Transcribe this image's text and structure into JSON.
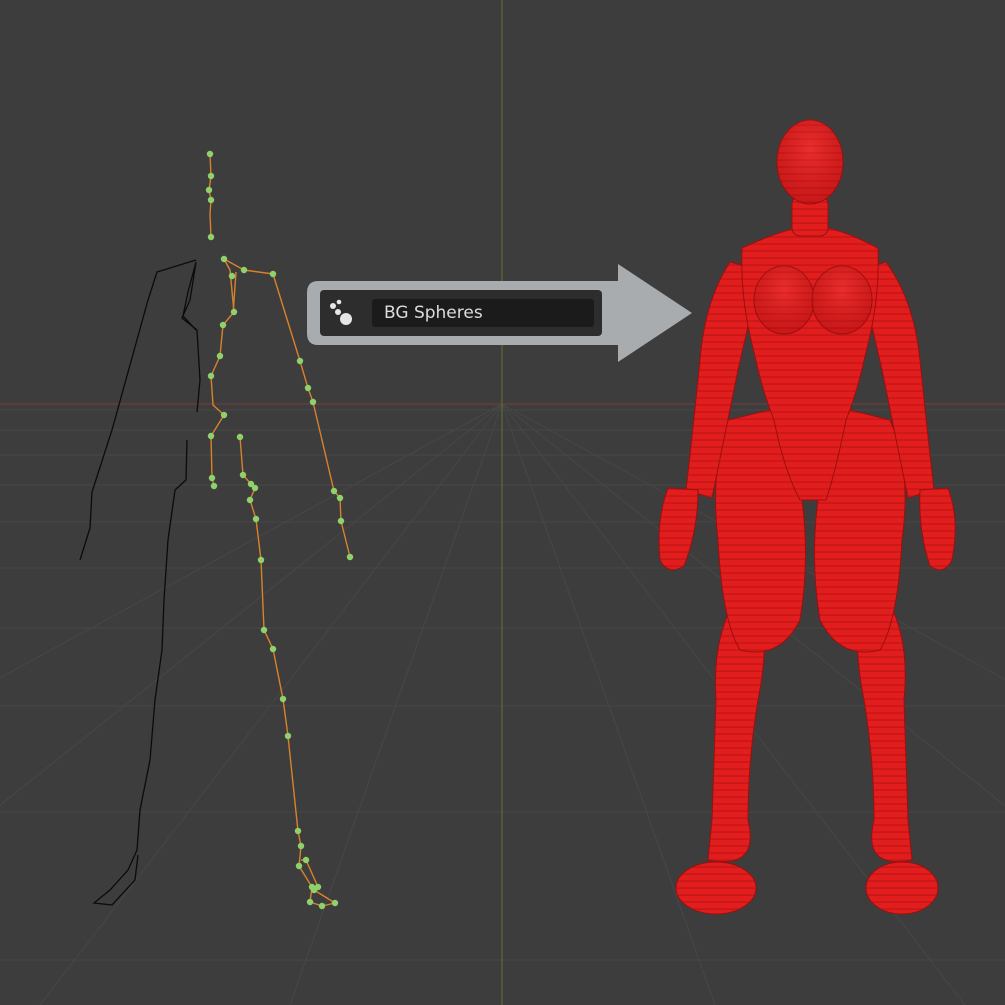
{
  "viewport": {
    "background": "#3d3d3d",
    "grid_color": "#464646",
    "axis_color_x": "#6b4040",
    "axis_color_y": "#5a6e33"
  },
  "armature": {
    "bone_color": "#d9822b",
    "joint_color": "#8fd16a",
    "outline_color": "#0a0a0a"
  },
  "callout": {
    "fill": "#a9acaf",
    "icon": "spheres-icon",
    "field_value": "BG Spheres"
  },
  "figure": {
    "mesh_color": "#e21d1d",
    "shade_color": "#b11010"
  }
}
